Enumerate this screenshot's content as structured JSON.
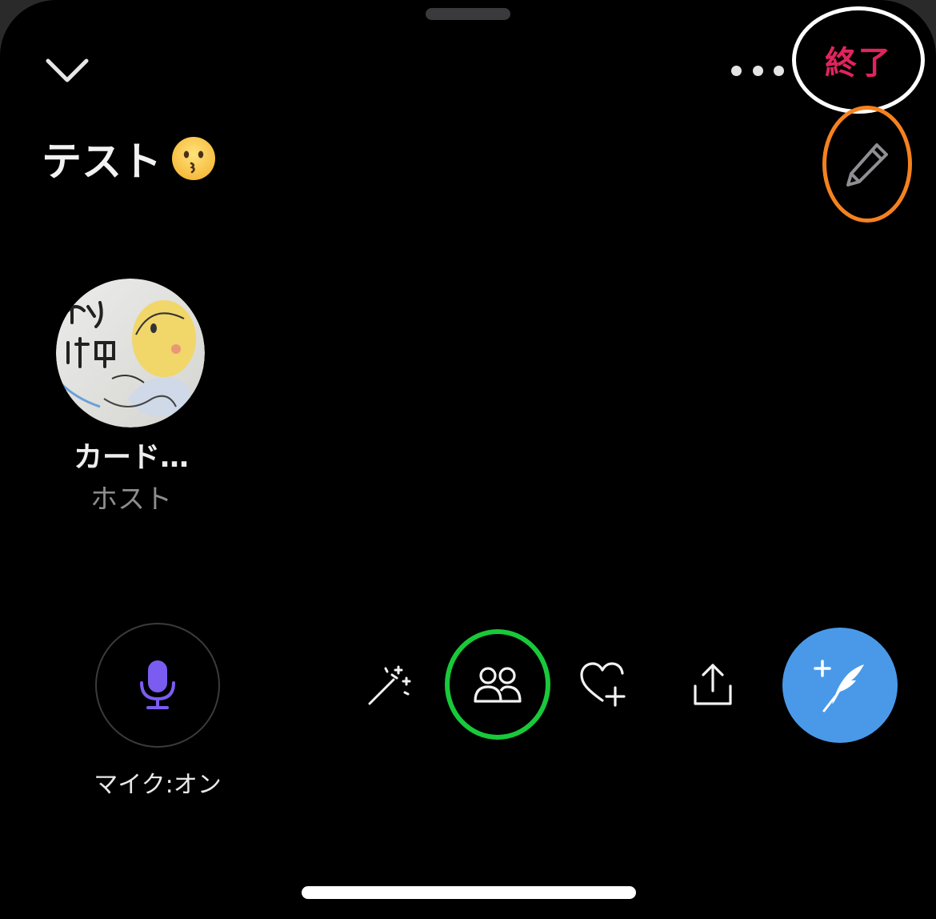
{
  "header": {
    "collapse_icon": "chevron-down-icon",
    "more_icon": "ellipsis-icon",
    "end_label": "終了"
  },
  "space": {
    "title": "テスト",
    "title_emoji": "kissing-face-emoji",
    "edit_icon": "pencil-icon"
  },
  "host": {
    "name": "カード…",
    "role": "ホスト"
  },
  "toolbar": {
    "mic_label": "マイク:オン",
    "items": [
      "magic-wand-icon",
      "people-icon",
      "heart-plus-icon",
      "share-icon",
      "compose-tweet-icon"
    ]
  },
  "colors": {
    "background": "#000000",
    "end": "#e0245e",
    "mic": "#7b5cf0",
    "compose": "#4a99e9",
    "annotation_white": "#ffffff",
    "annotation_orange": "#f5821f",
    "annotation_green": "#18c93a"
  }
}
